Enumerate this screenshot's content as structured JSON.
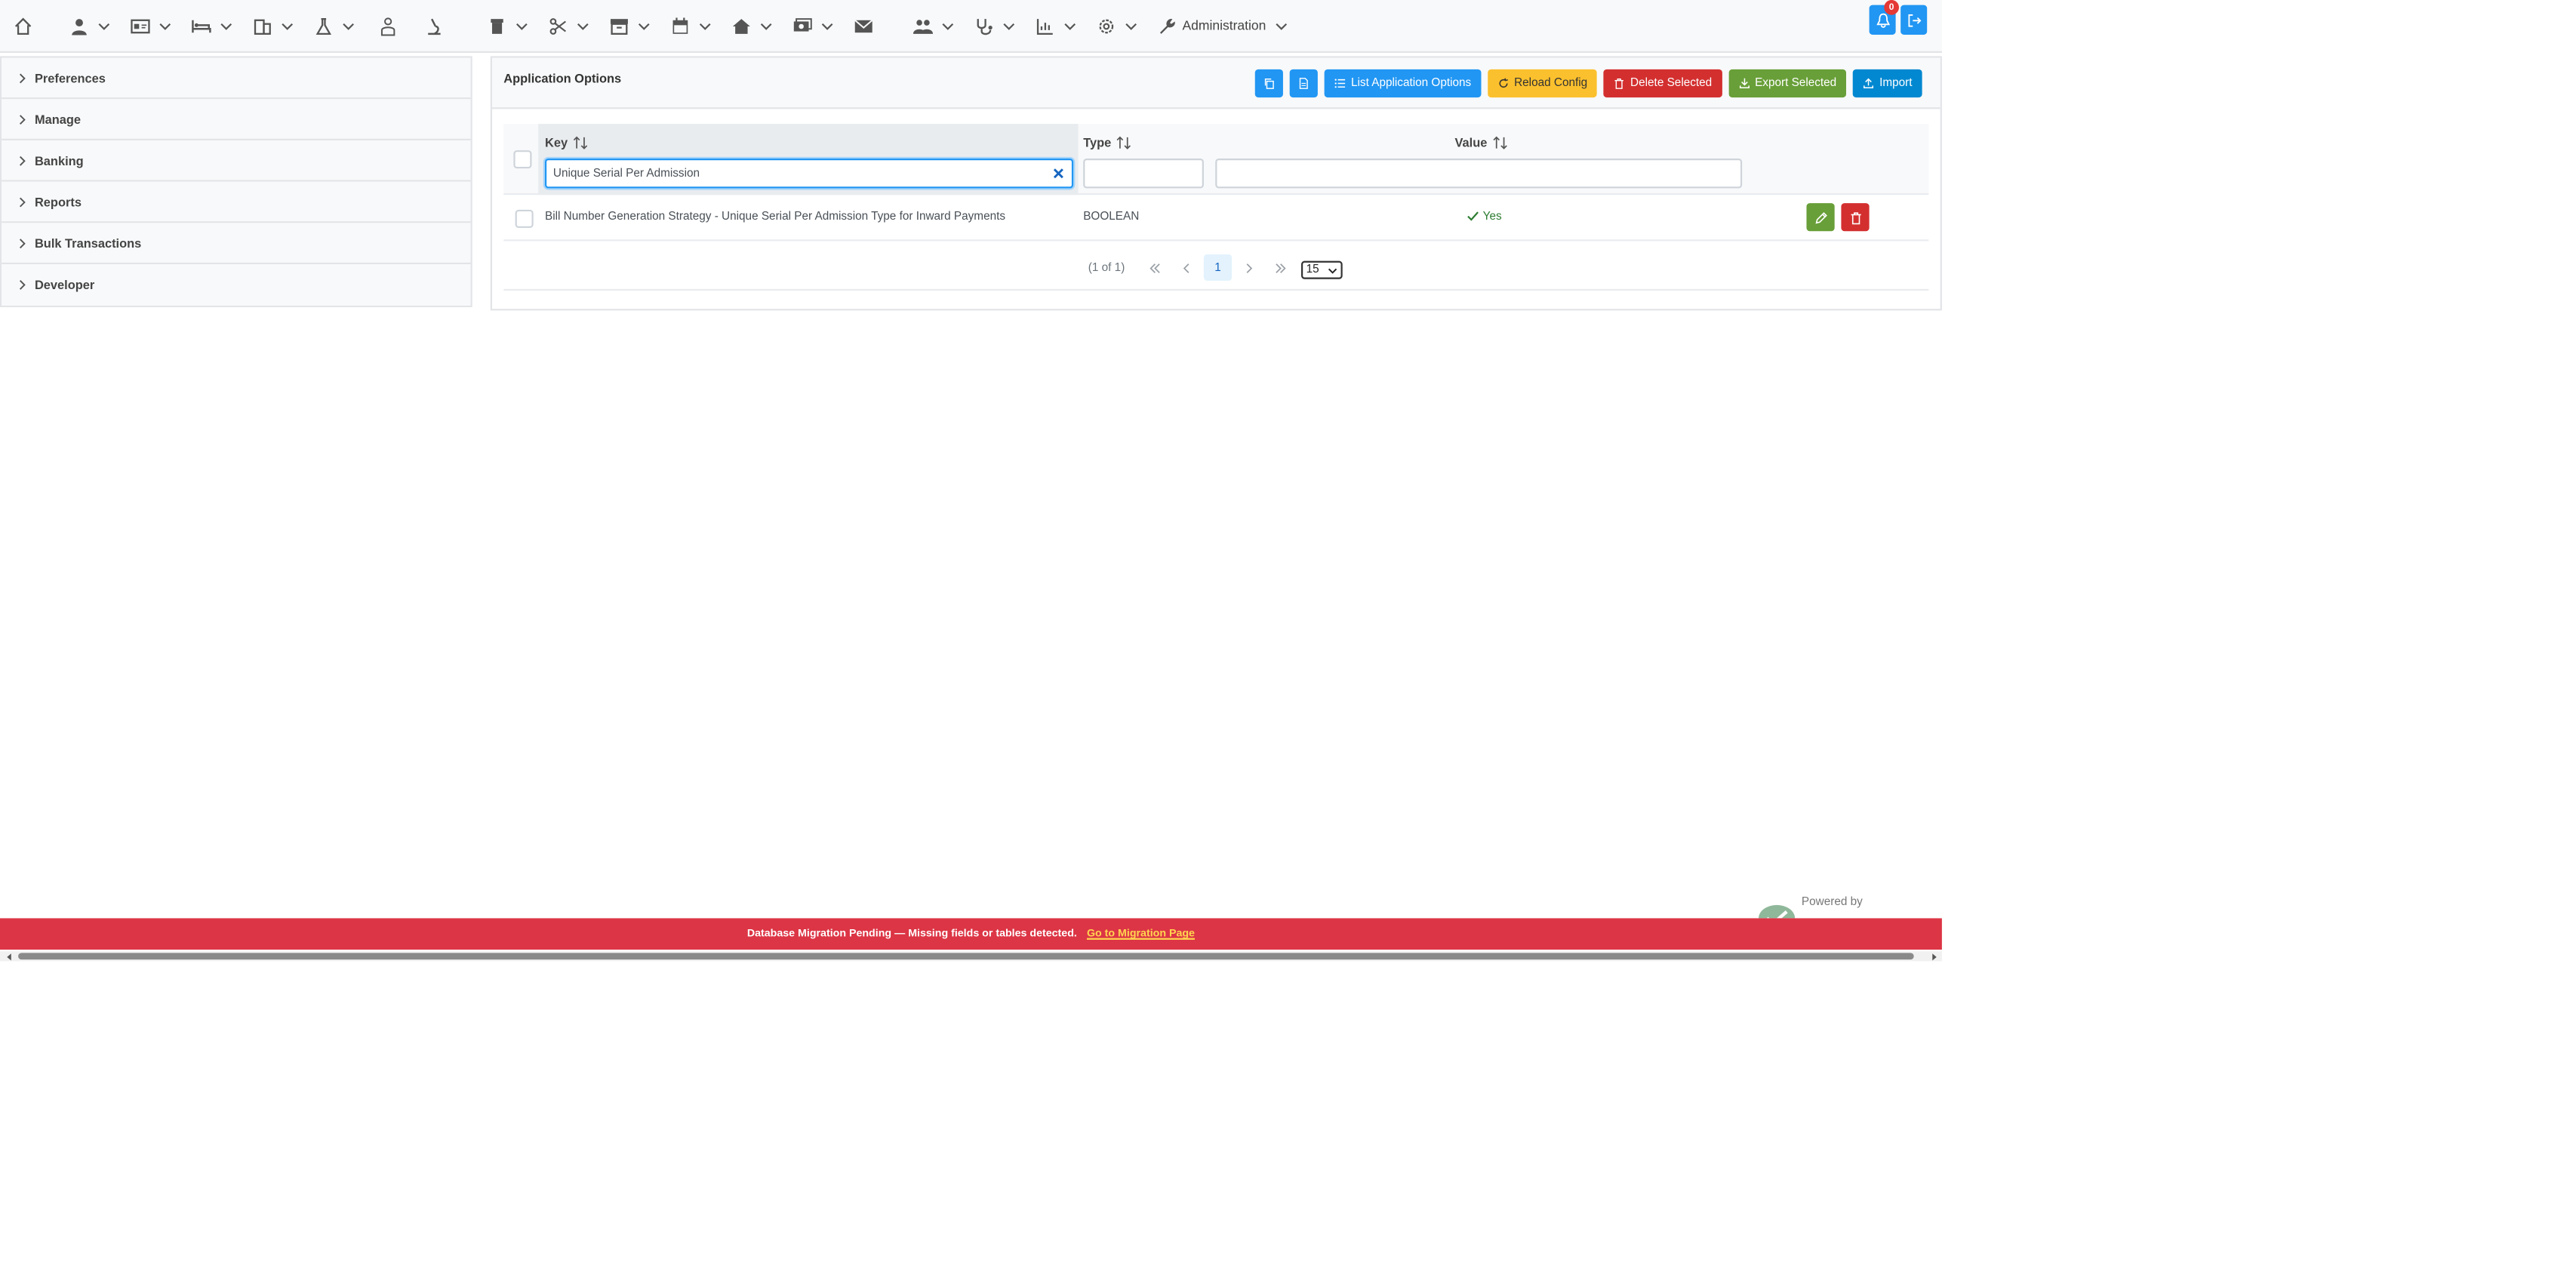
{
  "nav": {
    "administration_label": "Administration",
    "notification_count": "0"
  },
  "sidebar": {
    "items": [
      {
        "label": "Preferences"
      },
      {
        "label": "Manage"
      },
      {
        "label": "Banking"
      },
      {
        "label": "Reports"
      },
      {
        "label": "Bulk Transactions"
      },
      {
        "label": "Developer"
      }
    ]
  },
  "panel": {
    "title": "Application Options",
    "toolbar": {
      "list_label": "List Application Options",
      "reload_label": "Reload Config",
      "delete_label": "Delete Selected",
      "export_label": "Export Selected",
      "import_label": "Import"
    }
  },
  "table": {
    "columns": {
      "key": "Key",
      "type": "Type",
      "value": "Value"
    },
    "filters": {
      "key": "Unique Serial Per Admission",
      "type": "",
      "value": ""
    },
    "rows": [
      {
        "key": "Bill Number Generation Strategy - Unique Serial Per Admission Type for Inward Payments",
        "type": "BOOLEAN",
        "value": "Yes"
      }
    ],
    "paginator": {
      "report": "(1 of 1)",
      "current_page": "1",
      "rows_per_page": "15"
    }
  },
  "footer": {
    "powered_by": "Powered by",
    "migration_text": "Database Migration Pending — Missing fields or tables detected.",
    "migration_link": "Go to Migration Page"
  },
  "colors": {
    "primary": "#2196f3",
    "warning": "#fbc02d",
    "danger": "#d32f2f",
    "success": "#689f38",
    "banner": "#dc3545"
  }
}
